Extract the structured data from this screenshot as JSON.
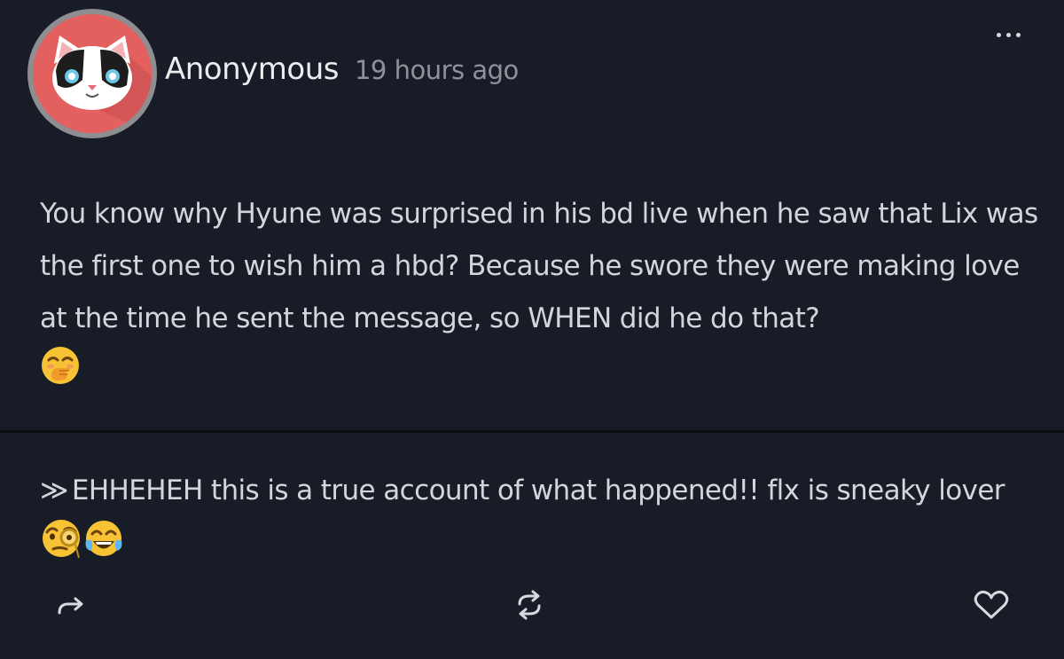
{
  "post": {
    "author": "Anonymous",
    "timestamp": "19 hours ago",
    "body": "You know why Hyune was surprised in his bd live when he saw that Lix was the first one to wish him a hbd? Because he swore they were making love at the time he sent the message, so WHEN did he do that?",
    "body_emoji": "🤭"
  },
  "answer": {
    "marker": "≫",
    "text": "EHHEHEH this is a true account of what happened!! flx is sneaky lover",
    "emojis": [
      "🧐",
      "😂"
    ]
  },
  "icons": {
    "avatar": "cat-avatar-icon",
    "more": "more-dots-icon",
    "share": "share-arrow-icon",
    "repost": "repost-icon",
    "like": "heart-icon"
  },
  "colors": {
    "background": "#181c26",
    "text": "#d2d5da",
    "muted": "#8c919a",
    "avatar_bg": "#e3605f",
    "avatar_ring": "#8e8e92"
  }
}
